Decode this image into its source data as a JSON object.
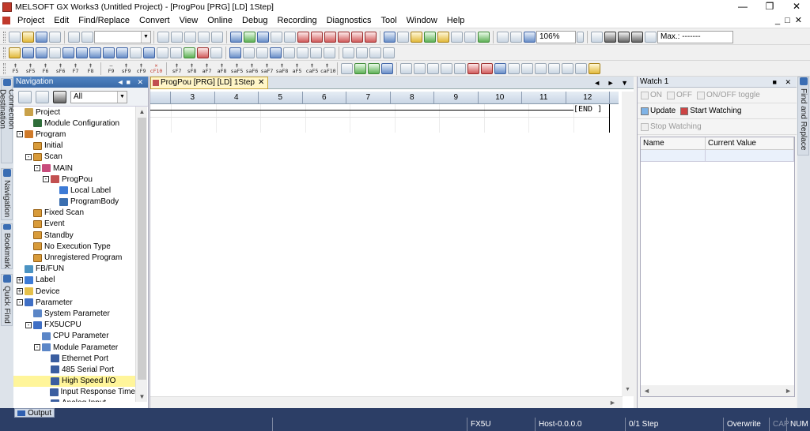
{
  "window": {
    "title": "MELSOFT GX Works3 (Untitled Project) - [ProgPou [PRG] [LD] 1Step]"
  },
  "menu": [
    "Project",
    "Edit",
    "Find/Replace",
    "Convert",
    "View",
    "Online",
    "Debug",
    "Recording",
    "Diagnostics",
    "Tool",
    "Window",
    "Help"
  ],
  "toolbar": {
    "zoom": "106%",
    "monitor_value": "Max.: -------"
  },
  "function_keys": [
    {
      "top": "‡",
      "bottom": "F5"
    },
    {
      "top": "‡",
      "bottom": "sF5"
    },
    {
      "top": "‡",
      "bottom": "F6"
    },
    {
      "top": "‡",
      "bottom": "sF6"
    },
    {
      "top": "‡",
      "bottom": "F7"
    },
    {
      "top": "‡",
      "bottom": "F8"
    },
    {
      "top": "—",
      "bottom": "F9"
    },
    {
      "top": "‡",
      "bottom": "sF9"
    },
    {
      "top": "‡",
      "bottom": "cF9"
    },
    {
      "top": "✕",
      "bottom": "cF10"
    },
    {
      "top": "‡",
      "bottom": "sF7"
    },
    {
      "top": "‡",
      "bottom": "sF8"
    },
    {
      "top": "‡",
      "bottom": "aF7"
    },
    {
      "top": "‡",
      "bottom": "aF8"
    },
    {
      "top": "‡",
      "bottom": "saF5"
    },
    {
      "top": "‡",
      "bottom": "saF6"
    },
    {
      "top": "‡",
      "bottom": "saF7"
    },
    {
      "top": "‡",
      "bottom": "saF8"
    },
    {
      "top": "‡",
      "bottom": "aF5"
    },
    {
      "top": "‡",
      "bottom": "caF5"
    },
    {
      "top": "‡",
      "bottom": "caF10"
    }
  ],
  "side_tabs": {
    "left": [
      "Connection Destination",
      "Navigation",
      "Bookmark",
      "Quick Find"
    ],
    "right": "Find and Replace"
  },
  "navigation": {
    "title": "Navigation",
    "filter": "All",
    "tree": [
      {
        "label": "Project",
        "level": 0,
        "toggle": "",
        "icon": "proj"
      },
      {
        "label": "Module Configuration",
        "level": 1,
        "toggle": "",
        "icon": "mod"
      },
      {
        "label": "Program",
        "level": 0,
        "toggle": "-",
        "icon": "prog"
      },
      {
        "label": "Initial",
        "level": 1,
        "toggle": "",
        "icon": "grp"
      },
      {
        "label": "Scan",
        "level": 1,
        "toggle": "-",
        "icon": "grp"
      },
      {
        "label": "MAIN",
        "level": 2,
        "toggle": "-",
        "icon": "main"
      },
      {
        "label": "ProgPou",
        "level": 3,
        "toggle": "-",
        "icon": "pou"
      },
      {
        "label": "Local Label",
        "level": 4,
        "toggle": "",
        "icon": "lbl"
      },
      {
        "label": "ProgramBody",
        "level": 4,
        "toggle": "",
        "icon": "body"
      },
      {
        "label": "Fixed Scan",
        "level": 1,
        "toggle": "",
        "icon": "grp"
      },
      {
        "label": "Event",
        "level": 1,
        "toggle": "",
        "icon": "grp"
      },
      {
        "label": "Standby",
        "level": 1,
        "toggle": "",
        "icon": "grp"
      },
      {
        "label": "No Execution Type",
        "level": 1,
        "toggle": "",
        "icon": "grp"
      },
      {
        "label": "Unregistered Program",
        "level": 1,
        "toggle": "",
        "icon": "grp"
      },
      {
        "label": "FB/FUN",
        "level": 0,
        "toggle": "",
        "icon": "fb"
      },
      {
        "label": "Label",
        "level": 0,
        "toggle": "+",
        "icon": "lbl"
      },
      {
        "label": "Device",
        "level": 0,
        "toggle": "+",
        "icon": "dev"
      },
      {
        "label": "Parameter",
        "level": 0,
        "toggle": "-",
        "icon": "par"
      },
      {
        "label": "System Parameter",
        "level": 1,
        "toggle": "",
        "icon": "cpu"
      },
      {
        "label": "FX5UCPU",
        "level": 1,
        "toggle": "-",
        "icon": "par"
      },
      {
        "label": "CPU Parameter",
        "level": 2,
        "toggle": "",
        "icon": "cpu"
      },
      {
        "label": "Module Parameter",
        "level": 2,
        "toggle": "-",
        "icon": "cpu"
      },
      {
        "label": "Ethernet Port",
        "level": 3,
        "toggle": "",
        "icon": "eth"
      },
      {
        "label": "485 Serial Port",
        "level": 3,
        "toggle": "",
        "icon": "eth"
      },
      {
        "label": "High Speed I/O",
        "level": 3,
        "toggle": "",
        "icon": "eth",
        "selected": true
      },
      {
        "label": "Input Response Time",
        "level": 3,
        "toggle": "",
        "icon": "eth"
      },
      {
        "label": "Analog Input",
        "level": 3,
        "toggle": "",
        "icon": "eth"
      }
    ]
  },
  "editor": {
    "tab_label": "ProgPou [PRG] [LD] 1Step",
    "columns": [
      "3",
      "4",
      "5",
      "6",
      "7",
      "8",
      "9",
      "10",
      "11",
      "12"
    ],
    "end_instruction": "[END  ]"
  },
  "watch": {
    "title": "Watch 1",
    "on": "ON",
    "off": "OFF",
    "toggle": "ON/OFF toggle",
    "update": "Update",
    "start": "Start Watching",
    "stop": "Stop Watching",
    "col_name": "Name",
    "col_value": "Current Value"
  },
  "output_tab": "Output",
  "status": {
    "model": "FX5U",
    "host": "Host-0.0.0.0",
    "step": "0/1 Step",
    "mode": "Overwrite",
    "cap": "CAP",
    "num": "NUM"
  }
}
